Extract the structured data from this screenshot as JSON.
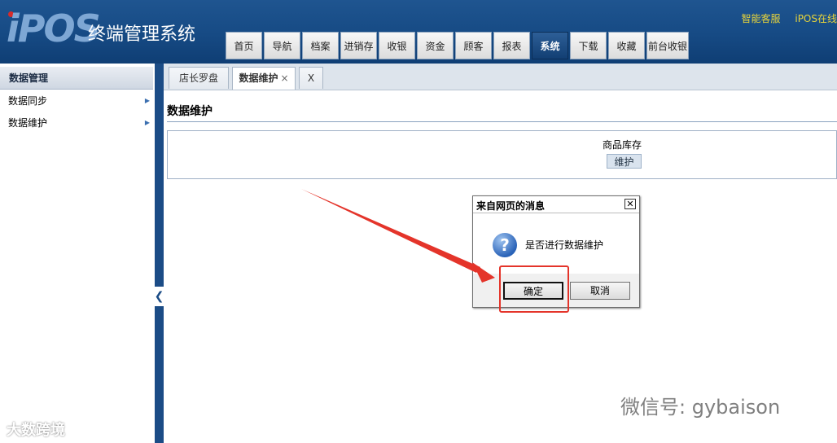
{
  "header": {
    "logo": "iPOS",
    "app_title": "终端管理系统",
    "top_links": [
      "智能客服",
      "iPOS在线"
    ]
  },
  "nav": {
    "tabs": [
      {
        "label": "首页"
      },
      {
        "label": "导航"
      },
      {
        "label": "档案"
      },
      {
        "label": "进销存"
      },
      {
        "label": "收银"
      },
      {
        "label": "资金"
      },
      {
        "label": "顾客"
      },
      {
        "label": "报表"
      },
      {
        "label": "系统"
      },
      {
        "label": "下载"
      },
      {
        "label": "收藏"
      },
      {
        "label": "前台收银"
      }
    ],
    "active": "系统"
  },
  "sidebar": {
    "title": "数据管理",
    "items": [
      {
        "label": "数据同步"
      },
      {
        "label": "数据维护"
      }
    ],
    "collapse_glyph": "❮"
  },
  "content": {
    "tabs": [
      {
        "label": "店长罗盘"
      },
      {
        "label": "数据维护",
        "close": "×"
      },
      {
        "label": "X"
      }
    ],
    "section_title": "数据维护",
    "inventory_label": "商品库存",
    "maintain_button": "维护"
  },
  "dialog": {
    "title": "来自网页的消息",
    "close_glyph": "✕",
    "icon": "question-icon",
    "icon_glyph": "?",
    "message": "是否进行数据维护",
    "ok_label": "确定",
    "cancel_label": "取消"
  },
  "annotation": {
    "color": "#e4342a"
  },
  "watermarks": {
    "left": "大数跨境",
    "right": "微信号: gybaison"
  },
  "colors": {
    "header_blue": "#164a84",
    "active_tab": "#123f73",
    "top_link_yellow": "#e8d43a"
  }
}
